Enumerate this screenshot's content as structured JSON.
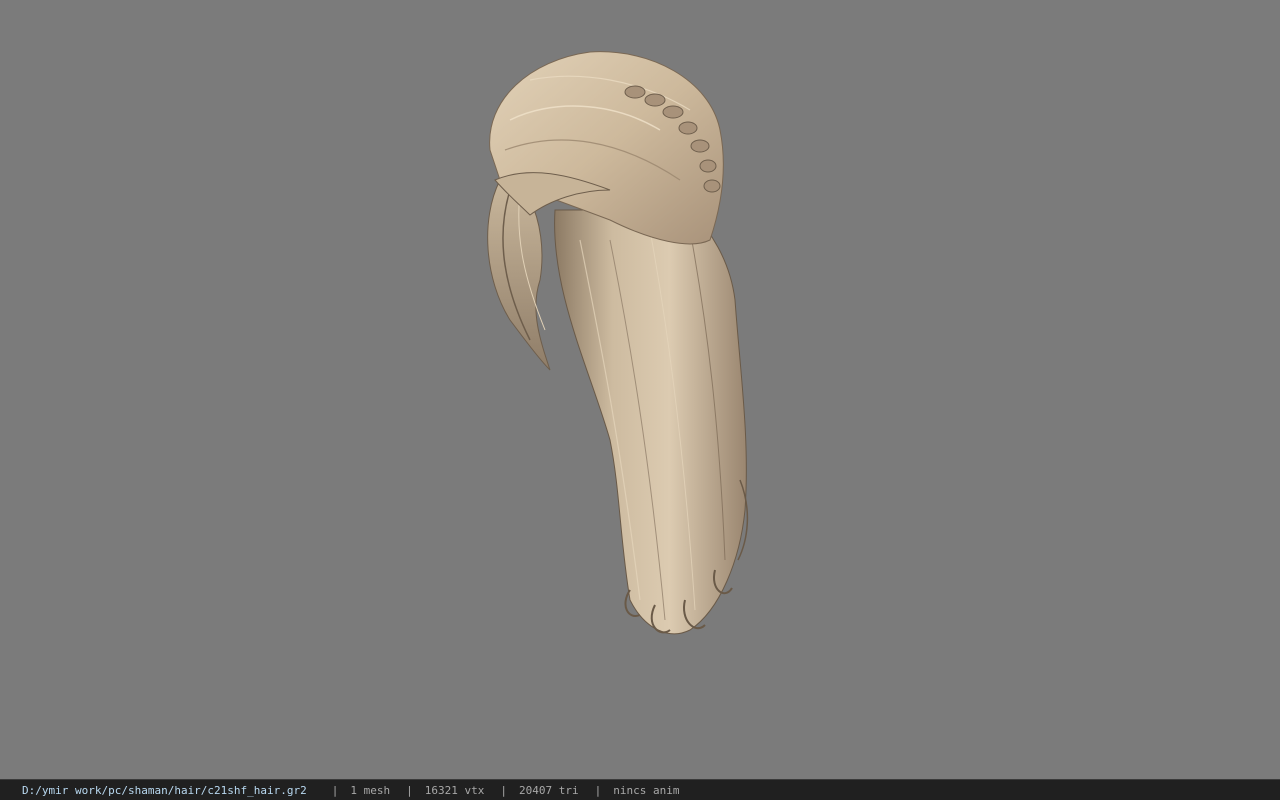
{
  "viewport": {
    "background": "#7b7b7b",
    "model_name": "hair-mesh",
    "hair_colors": {
      "light": "#d9c7ad",
      "mid": "#bba68a",
      "dark": "#7e6c58",
      "shadow": "#5e5246"
    }
  },
  "statusbar": {
    "file_path": "D:/ymir work/pc/shaman/hair/c21shf_hair.gr2",
    "separator": "|",
    "mesh_count": "1 mesh",
    "vertex_count": "16321 vtx",
    "triangle_count": "20407 tri",
    "anim_status": "nincs anim"
  }
}
